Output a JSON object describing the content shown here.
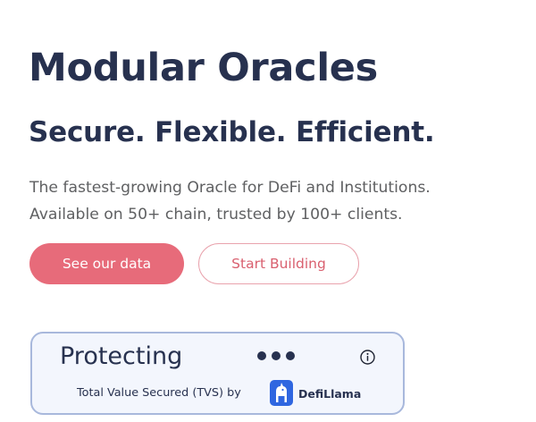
{
  "hero": {
    "title": "Modular Oracles",
    "subtitle": "Secure. Flexible. Efficient.",
    "description_line1": "The fastest-growing Oracle for DeFi and Institutions.",
    "description_line2": "Available on 50+ chain, trusted by 100+ clients."
  },
  "actions": {
    "primary_label": "See our data",
    "secondary_label": "Start Building"
  },
  "tvs_card": {
    "label": "Protecting",
    "caption": "Total Value Secured (TVS) by",
    "provider": "DefiLlama",
    "value_state": "loading-dots",
    "info_icon": "info-circle-icon",
    "provider_icon": "defillama-logo-icon"
  },
  "colors": {
    "heading": "#27314f",
    "body_text": "#5f6062",
    "accent": "#e76b7a",
    "card_border": "#a8b8dc",
    "card_background": "#f3f6fd"
  }
}
